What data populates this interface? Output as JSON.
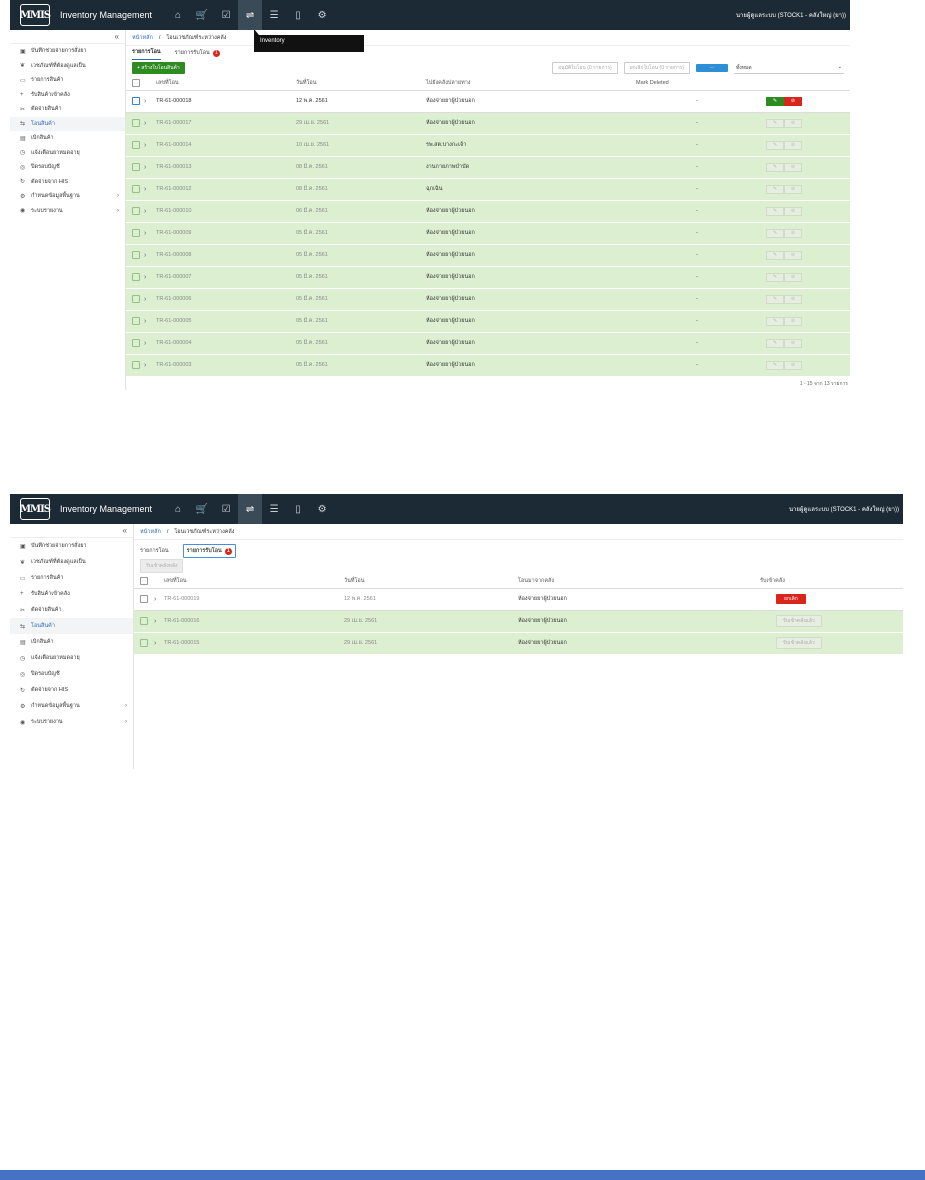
{
  "app": {
    "title": "Inventory Management",
    "logo_text": "MMIS",
    "user": "นายผู้ดูแลระบบ (STOCK1 - คลังใหญ่ (ยา))"
  },
  "nav_icons": [
    "home-icon",
    "cart-icon",
    "check-icon",
    "transfer-icon",
    "list-icon",
    "document-icon",
    "gear-icon"
  ],
  "sidebar": {
    "collapse": "«",
    "items": [
      {
        "label": "บันทึกช่วยจ่ายการสั่งยา",
        "icon": "▣"
      },
      {
        "label": "เวชภัณฑ์ที่ต้องดูแลเป็น",
        "icon": "❦"
      },
      {
        "label": "รายการสินค้า",
        "icon": "▭"
      },
      {
        "label": "รับสินค้าเข้าคลัง",
        "icon": "+"
      },
      {
        "label": "ตัดจ่ายสินค้า",
        "icon": "✂"
      },
      {
        "label": "โอนสินค้า",
        "icon": "⇆"
      },
      {
        "label": "เบิกสินค้า",
        "icon": "▤"
      },
      {
        "label": "แจ้งเตือนยาหมดอายุ",
        "icon": "◷"
      },
      {
        "label": "ปิดรอบบัญชี",
        "icon": "◎"
      },
      {
        "label": "ตัดจ่ายจาก HIS",
        "icon": "↻"
      },
      {
        "label": "กำหนดข้อมูลพื้นฐาน",
        "icon": "⚙"
      },
      {
        "label": "ระบบรายงาน",
        "icon": "◉"
      }
    ]
  },
  "breadcrumb": {
    "home": "หน้าหลัก",
    "sep": "/",
    "current": "โอนเวชภัณฑ์ระหว่างคลัง"
  },
  "tabs": {
    "transfer": "รายการโอน",
    "receive": "รายการรับโอน",
    "badge": "1"
  },
  "tooltip": "Inventory",
  "shot1": {
    "create_button": "+ สร้างใบโอนสินค้า",
    "approve_button": "อนุมัติใบโอน (0 รายการ)",
    "cancel_button": "ยกเลิกใบโอน (0 รายการ)",
    "filter_value": "ทั้งหมด",
    "columns": [
      "เลขที่โอน",
      "วันที่โอน",
      "ไปยังคลังปลายทาง",
      "Mark Deleted"
    ],
    "rows": [
      {
        "no": "TR-61-000018",
        "date": "12 พ.ค. 2561",
        "dest": "ห้องจ่ายยาผู้ป่วยนอก",
        "mark": "-",
        "style": "white"
      },
      {
        "no": "TR-61-000017",
        "date": "29 เม.ย. 2561",
        "dest": "ห้องจ่ายยาผู้ป่วยนอก",
        "mark": "-",
        "style": "green"
      },
      {
        "no": "TR-61-000014",
        "date": "10 เม.ย. 2561",
        "dest": "รพ.สต.บางกะเจ้า",
        "mark": "-",
        "style": "green"
      },
      {
        "no": "TR-61-000013",
        "date": "08 มี.ค. 2561",
        "dest": "งานกายภาพบำบัด",
        "mark": "-",
        "style": "green"
      },
      {
        "no": "TR-61-000012",
        "date": "08 มี.ค. 2561",
        "dest": "ฉุกเฉิน",
        "mark": "-",
        "style": "green"
      },
      {
        "no": "TR-61-000010",
        "date": "06 มี.ค. 2561",
        "dest": "ห้องจ่ายยาผู้ป่วยนอก",
        "mark": "-",
        "style": "green"
      },
      {
        "no": "TR-61-000009",
        "date": "05 มี.ค. 2561",
        "dest": "ห้องจ่ายยาผู้ป่วยนอก",
        "mark": "-",
        "style": "green"
      },
      {
        "no": "TR-61-000008",
        "date": "05 มี.ค. 2561",
        "dest": "ห้องจ่ายยาผู้ป่วยนอก",
        "mark": "-",
        "style": "green"
      },
      {
        "no": "TR-61-000007",
        "date": "05 มี.ค. 2561",
        "dest": "ห้องจ่ายยาผู้ป่วยนอก",
        "mark": "-",
        "style": "green"
      },
      {
        "no": "TR-61-000006",
        "date": "05 มี.ค. 2561",
        "dest": "ห้องจ่ายยาผู้ป่วยนอก",
        "mark": "-",
        "style": "green"
      },
      {
        "no": "TR-61-000005",
        "date": "05 มี.ค. 2561",
        "dest": "ห้องจ่ายยาผู้ป่วยนอก",
        "mark": "-",
        "style": "green"
      },
      {
        "no": "TR-61-000004",
        "date": "05 มี.ค. 2561",
        "dest": "ห้องจ่ายยาผู้ป่วยนอก",
        "mark": "-",
        "style": "green"
      },
      {
        "no": "TR-61-000003",
        "date": "05 มี.ค. 2561",
        "dest": "ห้องจ่ายยาผู้ป่วยนอก",
        "mark": "-",
        "style": "green"
      }
    ],
    "pager": "1 - 15 จาก 13 รายการ"
  },
  "shot2": {
    "receive_button": "รับเข้าคลังหลัง",
    "columns": [
      "เลขที่โอน",
      "วันที่โอน",
      "โอนมาจากคลัง",
      "รับเข้าคลัง"
    ],
    "rows": [
      {
        "no": "TR-61-000019",
        "date": "12 พ.ค. 2561",
        "src": "ห้องจ่ายยาผู้ป่วยนอก",
        "action": "ยกเลิก",
        "style": "white"
      },
      {
        "no": "TR-61-000016",
        "date": "29 เม.ย. 2561",
        "src": "ห้องจ่ายยาผู้ป่วยนอก",
        "action": "รับเข้าคลังแล้ว",
        "style": "green"
      },
      {
        "no": "TR-61-000015",
        "date": "29 เม.ย. 2561",
        "src": "ห้องจ่ายยาผู้ป่วยนอก",
        "action": "รับเข้าคลังแล้ว",
        "style": "green"
      }
    ]
  }
}
